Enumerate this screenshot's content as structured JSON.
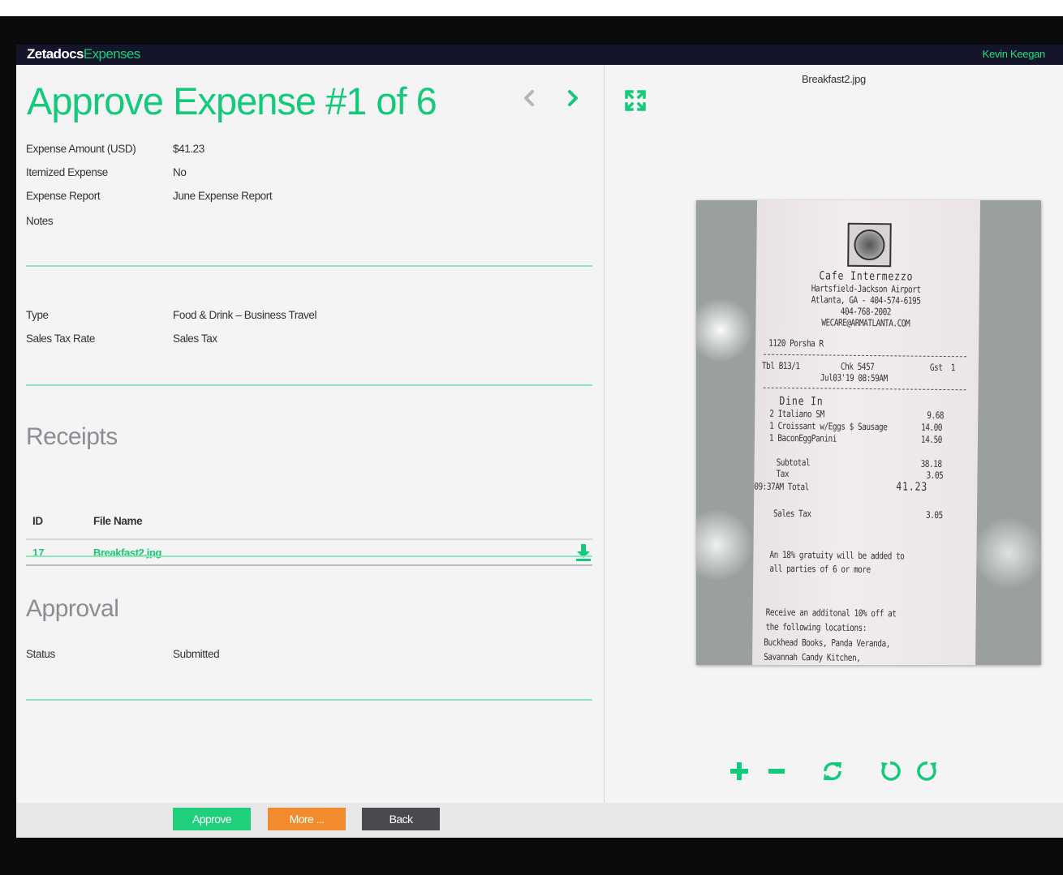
{
  "app": {
    "brand_part1": "Zetadocs",
    "brand_part2": "Expenses",
    "user_name": "Kevin Keegan"
  },
  "header": {
    "title": "Approve Expense #1 of 6",
    "prev_icon": "chevron-left-icon",
    "next_icon": "chevron-right-icon"
  },
  "details": [
    {
      "label": "Expense Amount (USD)",
      "value": "$41.23"
    },
    {
      "label": "Itemized Expense",
      "value": "No"
    },
    {
      "label": "Expense Report",
      "value": "June Expense Report"
    },
    {
      "label": "Notes",
      "value": ""
    }
  ],
  "classification": [
    {
      "label": "Type",
      "value": "Food & Drink – Business Travel"
    },
    {
      "label": "Sales Tax Rate",
      "value": "Sales Tax"
    }
  ],
  "receipts": {
    "title": "Receipts",
    "columns": [
      "ID",
      "File Name"
    ],
    "rows": [
      {
        "id": "17",
        "file_name": "Breakfast2.jpg",
        "action_icon": "download-icon"
      }
    ]
  },
  "approval": {
    "title": "Approval",
    "status_label": "Status",
    "status_value": "Submitted"
  },
  "viewer": {
    "file_name": "Breakfast2.jpg",
    "expand_icon": "expand-icon",
    "receipt_lines": {
      "name": "Cafe Intermezzo",
      "addr1": "Hartsfield-Jackson Airport",
      "addr2": "Atlanta, GA - 404-574-6195",
      "phone": "404-768-2002",
      "email": "WECARE@ARMATLANTA.COM",
      "server": "1120 Porsha R",
      "tbl": "Tbl B13/1",
      "chk": "Chk 5457",
      "gst": "Gst  1",
      "date": "Jul03'19 08:59AM",
      "dine": "Dine In",
      "item1": "2 Italiano SM",
      "item1_price": "9.68",
      "item2": "1 Croissant w/Eggs $ Sausage",
      "item2_price": "14.00",
      "item3": "1 BaconEggPanini",
      "item3_price": "14.50",
      "subtotal_label": "Subtotal",
      "subtotal": "38.18",
      "tax_label": "Tax",
      "tax": "3.05",
      "total_label": "09:37AM Total",
      "total": "41.23",
      "sales_tax_label": "Sales Tax",
      "sales_tax": "3.05",
      "note1": "An 18% gratuity will be added to",
      "note2": "all parties of 6 or more",
      "promo1": "Receive an additonal 10% off at",
      "promo2": "the following locations:",
      "promo3": "Buckhead Books, Panda Veranda,",
      "promo4": "Savannah Candy Kitchen,"
    },
    "tools": [
      "zoom-in-icon",
      "zoom-out-icon",
      "reset-icon",
      "rotate-left-icon",
      "rotate-right-icon"
    ]
  },
  "footer": {
    "approve_label": "Approve",
    "more_label": "More ...",
    "back_label": "Back"
  },
  "colors": {
    "accent_green": "#13c97a",
    "topbar": "#14142a",
    "more_orange": "#f28a2e",
    "back_gray": "#4a4a4e"
  }
}
